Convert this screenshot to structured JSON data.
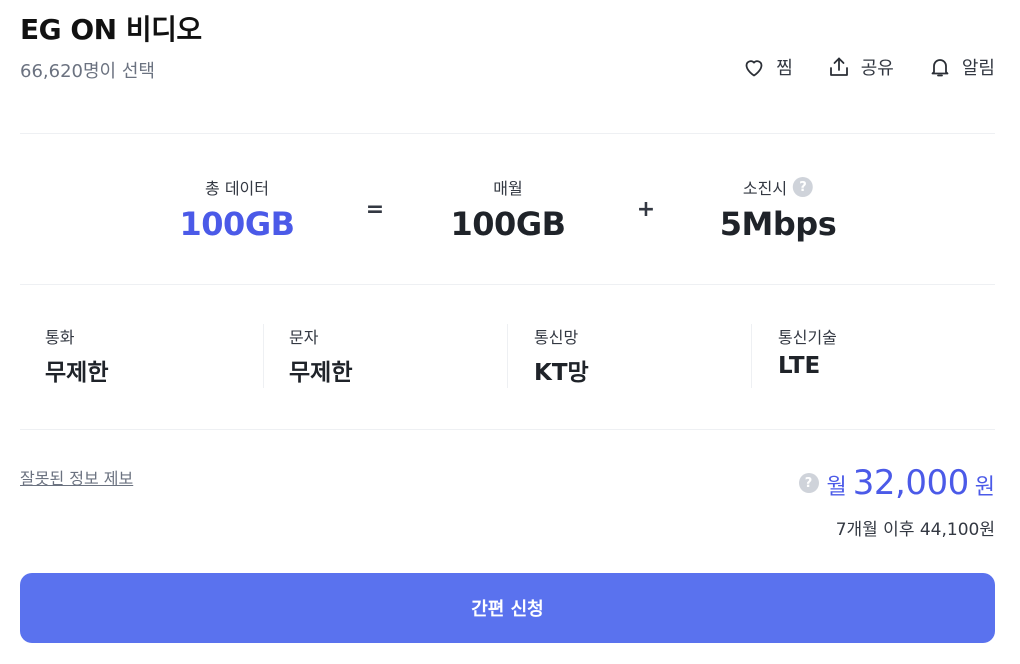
{
  "plan": {
    "title": "EG ON 비디오",
    "selected_count": "66,620명이 선택"
  },
  "actions": [
    {
      "label": "찜",
      "icon": "heart-icon"
    },
    {
      "label": "공유",
      "icon": "share-icon"
    },
    {
      "label": "알림",
      "icon": "bell-icon"
    }
  ],
  "data_summary": {
    "total": {
      "label": "총 데이터",
      "value": "100GB"
    },
    "equals": "=",
    "monthly": {
      "label": "매월",
      "value": "100GB"
    },
    "plus": "+",
    "exhausted": {
      "label": "소진시",
      "value": "5Mbps",
      "help": "?"
    }
  },
  "specs": [
    {
      "label": "통화",
      "value": "무제한"
    },
    {
      "label": "문자",
      "value": "무제한"
    },
    {
      "label": "통신망",
      "value": "KT망"
    },
    {
      "label": "통신기술",
      "value": "LTE"
    }
  ],
  "report_link": "잘못된 정보 제보",
  "price": {
    "help": "?",
    "prefix": "월",
    "amount": "32,000",
    "unit": "원",
    "after": "7개월 이후 44,100원"
  },
  "apply_button": "간편 신청",
  "colors": {
    "accent": "#4b5ae8",
    "button": "#5a72ee",
    "divider": "#eef0f3"
  }
}
